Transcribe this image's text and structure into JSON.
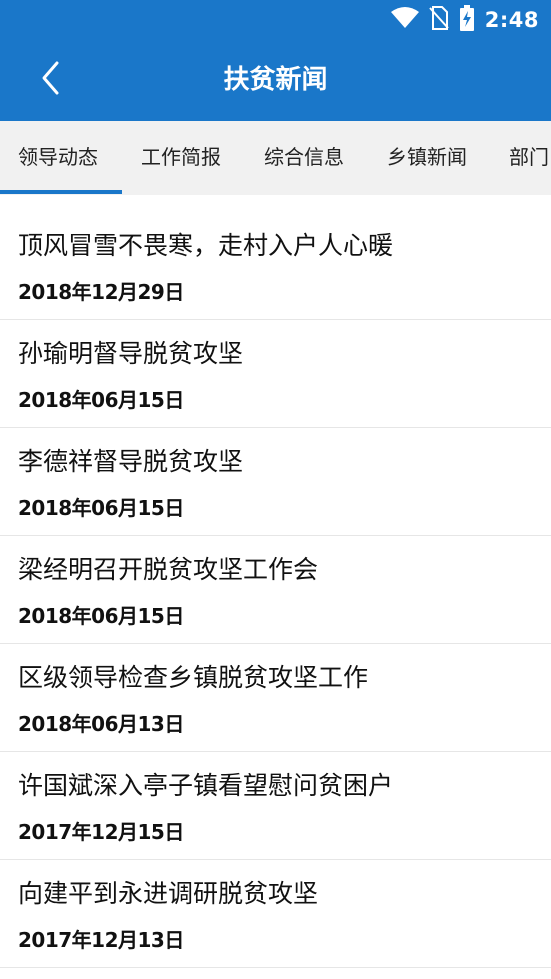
{
  "status_bar": {
    "time": "2:48",
    "icons": [
      "wifi-icon",
      "no-sim-icon",
      "battery-charging-icon"
    ]
  },
  "header": {
    "title": "扶贫新闻",
    "back_icon": "chevron-left-icon",
    "background": "#1a77c9"
  },
  "tabs": [
    {
      "label": "领导动态",
      "active": true
    },
    {
      "label": "工作简报",
      "active": false
    },
    {
      "label": "综合信息",
      "active": false
    },
    {
      "label": "乡镇新闻",
      "active": false
    },
    {
      "label": "部门",
      "active": false
    }
  ],
  "news": [
    {
      "title": "顶风冒雪不畏寒，走村入户人心暖",
      "date": "2018年12月29日"
    },
    {
      "title": "孙瑜明督导脱贫攻坚",
      "date": "2018年06月15日"
    },
    {
      "title": "李德祥督导脱贫攻坚",
      "date": "2018年06月15日"
    },
    {
      "title": "梁经明召开脱贫攻坚工作会",
      "date": "2018年06月15日"
    },
    {
      "title": "区级领导检查乡镇脱贫攻坚工作",
      "date": "2018年06月13日"
    },
    {
      "title": "许国斌深入亭子镇看望慰问贫困户",
      "date": "2017年12月15日"
    },
    {
      "title": "向建平到永进调研脱贫攻坚",
      "date": "2017年12月13日"
    }
  ]
}
